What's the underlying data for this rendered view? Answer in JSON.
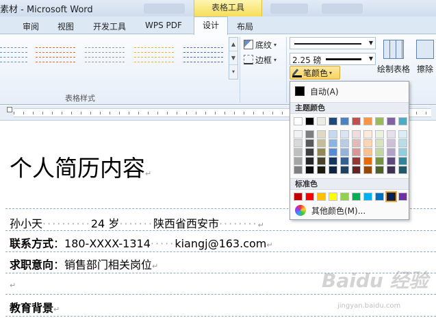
{
  "window": {
    "title": "素材 - Microsoft Word",
    "context_group": "表格工具"
  },
  "tabs": [
    "审阅",
    "视图",
    "开发工具",
    "WPS PDF"
  ],
  "context_tabs": {
    "design": "设计",
    "layout": "布局"
  },
  "ribbon": {
    "group_label": "表格样式",
    "shading": "底纹",
    "borders": "边框",
    "line_weight": "2.25 磅",
    "pen_color": "笔颜色",
    "draw_table": "绘制表格",
    "eraser": "擦除"
  },
  "gallery_colors": [
    "#5b8dd6",
    "#e46c2e",
    "#9a9a9a",
    "#f0b820",
    "#4c6fc2"
  ],
  "color_menu": {
    "automatic": "自动(A)",
    "theme_header": "主题颜色",
    "standard_header": "标准色",
    "more_colors": "其他颜色(M)...",
    "theme_colors": [
      [
        "#ffffff",
        "#f2f2f2",
        "#d8d8d8",
        "#bfbfbf",
        "#a5a5a5",
        "#7f7f7f"
      ],
      [
        "#000000",
        "#7f7f7f",
        "#595959",
        "#3f3f3f",
        "#262626",
        "#0c0c0c"
      ],
      [
        "#eeece1",
        "#ddd9c3",
        "#c4bd97",
        "#938953",
        "#494429",
        "#1d1b10"
      ],
      [
        "#1f497d",
        "#c6d9f0",
        "#8db3e2",
        "#548dd4",
        "#17365d",
        "#0f243e"
      ],
      [
        "#4f81bd",
        "#dbe5f1",
        "#b8cce4",
        "#95b3d7",
        "#366092",
        "#244061"
      ],
      [
        "#c0504d",
        "#f2dcdb",
        "#e5b9b7",
        "#d99694",
        "#953734",
        "#632423"
      ],
      [
        "#f79646",
        "#fdeada",
        "#fbd5b5",
        "#fac08f",
        "#e36c09",
        "#974806"
      ],
      [
        "#9bbb59",
        "#ebf1dd",
        "#d7e3bc",
        "#c3d69b",
        "#76923c",
        "#4f6128"
      ],
      [
        "#8064a2",
        "#e5e0ec",
        "#ccc1d9",
        "#b2a2c7",
        "#5f497a",
        "#3f3151"
      ],
      [
        "#4bacc6",
        "#dbeef3",
        "#b7dde8",
        "#92cddc",
        "#31859b",
        "#205867"
      ]
    ],
    "standard_colors": [
      "#c00000",
      "#ff0000",
      "#ffc000",
      "#ffff00",
      "#92d050",
      "#00b050",
      "#00b0f0",
      "#0070c0",
      "#002060",
      "#7030a0"
    ],
    "selected_standard_index": 8
  },
  "document": {
    "heading": "个人简历内容",
    "rows": [
      {
        "name": "孙小天",
        "age": "24 岁",
        "place": "陕西省西安市"
      },
      {
        "label": "联系方式",
        "phone": "：180-XXXX-1314",
        "email": "kiangj@163.com"
      },
      {
        "label": "求职意向",
        "value": "：销售部门相关岗位"
      },
      {
        "label": ""
      },
      {
        "label": "教育背景"
      }
    ]
  },
  "watermark": {
    "text": "Baidu 经验",
    "sub": "jingyan.baidu.com"
  }
}
